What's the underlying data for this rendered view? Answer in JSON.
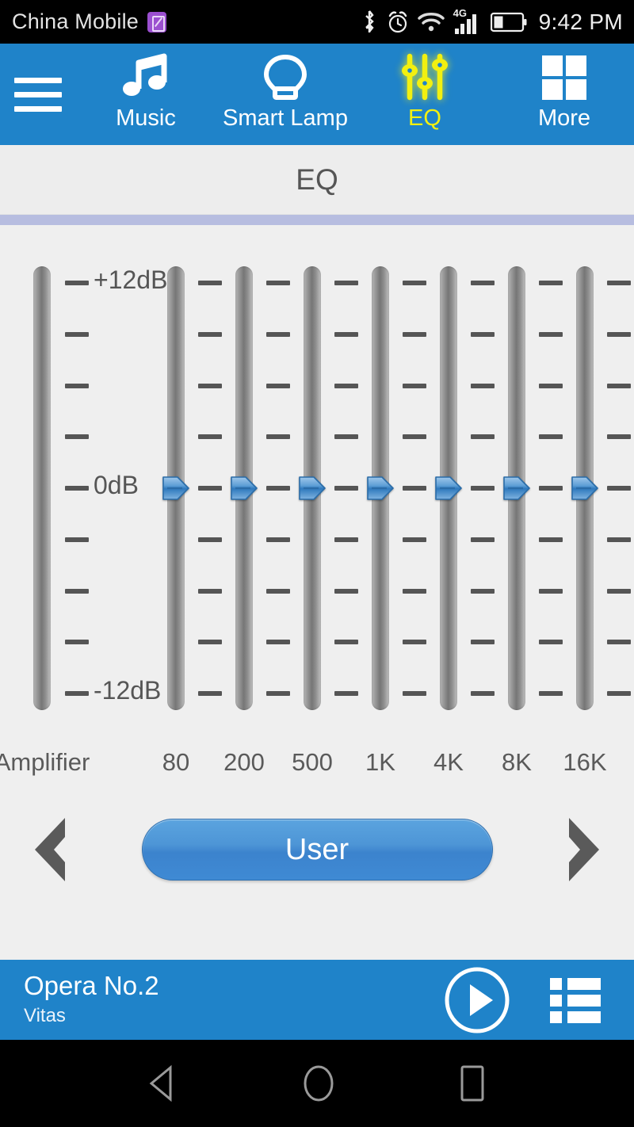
{
  "statusbar": {
    "carrier": "China Mobile",
    "sim_icon": "sim-card-icon",
    "bluetooth_icon": "bluetooth-icon",
    "alarm_icon": "alarm-clock-icon",
    "wifi_icon": "wifi-icon",
    "network_type": "4G",
    "signal_icon": "signal-bars-icon",
    "battery_icon": "battery-icon",
    "time": "9:42 PM"
  },
  "navbar": {
    "menu_icon": "hamburger-menu-icon",
    "items": [
      {
        "label": "Music",
        "icon": "music-note-icon",
        "active": false
      },
      {
        "label": "Smart Lamp",
        "icon": "light-bulb-icon",
        "active": false
      },
      {
        "label": "EQ",
        "icon": "equalizer-icon",
        "active": true
      },
      {
        "label": "More",
        "icon": "grid-squares-icon",
        "active": false
      }
    ],
    "background": "#1f83c9",
    "active_color": "#f2f010"
  },
  "page": {
    "title": "EQ",
    "divider_color": "#b7bde0"
  },
  "equalizer": {
    "scale_labels": [
      {
        "text": "+12dB",
        "db": 12
      },
      {
        "text": "0dB",
        "db": 0
      },
      {
        "text": "-12dB",
        "db": -12
      }
    ],
    "tick_count": 9,
    "range": {
      "min": -12,
      "max": 12,
      "step": 3
    },
    "master": {
      "label": "Amplifier",
      "has_thumb": false
    },
    "bands": [
      {
        "label": "80",
        "value_db": 0
      },
      {
        "label": "200",
        "value_db": 0
      },
      {
        "label": "500",
        "value_db": 0
      },
      {
        "label": "1K",
        "value_db": 0
      },
      {
        "label": "4K",
        "value_db": 0
      },
      {
        "label": "8K",
        "value_db": 0
      },
      {
        "label": "16K",
        "value_db": 0
      }
    ]
  },
  "preset": {
    "prev_icon": "chevron-left-icon",
    "next_icon": "chevron-right-icon",
    "current": "User"
  },
  "now_playing": {
    "title": "Opera No.2",
    "artist": "Vitas",
    "play_icon": "play-circle-icon",
    "playlist_icon": "playlist-icon"
  },
  "android_nav": {
    "back_icon": "back-triangle-icon",
    "home_icon": "home-circle-icon",
    "recents_icon": "recents-square-icon"
  }
}
